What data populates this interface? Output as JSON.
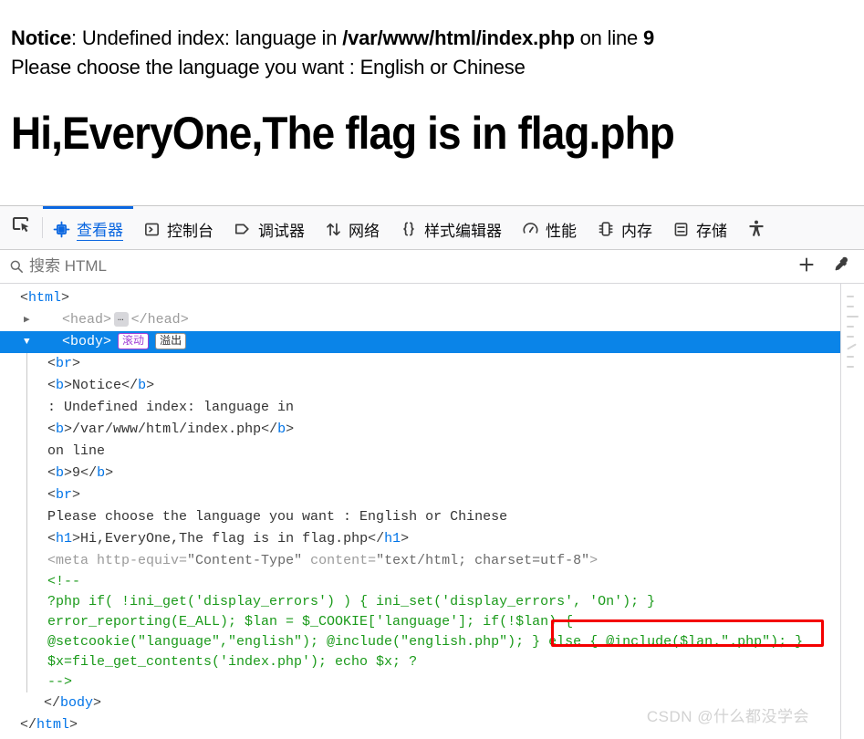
{
  "rendered_page": {
    "notice_prefix_bold": "Notice",
    "notice_middle": ": Undefined index: language in ",
    "notice_path_bold": "/var/www/html/index.php",
    "notice_online": " on line ",
    "notice_line_bold": "9",
    "second_line": "Please choose the language you want : English or Chinese",
    "heading": "Hi,EveryOne,The flag is in flag.php"
  },
  "devtools": {
    "picker_icon": "element-picker-icon",
    "tabs": [
      {
        "label": "查看器",
        "icon": "inspector-icon",
        "active": true
      },
      {
        "label": "控制台",
        "icon": "console-icon",
        "active": false
      },
      {
        "label": "调试器",
        "icon": "debugger-icon",
        "active": false
      },
      {
        "label": "网络",
        "icon": "network-icon",
        "active": false
      },
      {
        "label": "样式编辑器",
        "icon": "style-editor-icon",
        "active": false
      },
      {
        "label": "性能",
        "icon": "performance-icon",
        "active": false
      },
      {
        "label": "内存",
        "icon": "memory-icon",
        "active": false
      },
      {
        "label": "存储",
        "icon": "storage-icon",
        "active": false
      },
      {
        "label": "",
        "icon": "accessibility-icon",
        "active": false
      }
    ],
    "search": {
      "placeholder": "搜索 HTML",
      "value": "",
      "icon": "search-icon",
      "add_node_icon": "add-node-icon",
      "eyedropper_icon": "eyedropper-icon"
    },
    "accent_color": "#0a66e0",
    "selection_color": "#0a84e8",
    "highlight_color": "#f40000"
  },
  "markup": {
    "badges": {
      "scroll": "滚动",
      "overflow": "溢出"
    },
    "rows": {
      "html_open": {
        "open": "<",
        "name": "html",
        "close": ">"
      },
      "head": {
        "open": "<",
        "name": "head",
        "close": ">",
        "ellipsis": "…",
        "close_open": "</",
        "close_name": "head",
        "close_end": ">"
      },
      "body_open": {
        "open": "<",
        "name": "body",
        "close": ">"
      },
      "br1": "<br>",
      "b_notice_open": "<b>",
      "b_notice_text": "Notice",
      "b_notice_close": "</b>",
      "text_undefined": ": Undefined index: language in",
      "b_path_open": "<b>",
      "b_path_text": "/var/www/html/index.php",
      "b_path_close": "</b>",
      "text_online": "on line",
      "b_nine_open": "<b>",
      "b_nine_text": "9",
      "b_nine_close": "</b>",
      "br2": "<br>",
      "text_please": "Please choose the language you want : English or Chinese",
      "h1_open": "<h1>",
      "h1_text": "Hi,EveryOne,The flag is in flag.php",
      "h1_close": "</h1>",
      "meta_open": "<meta ",
      "meta_attr1_name": "http-equiv",
      "meta_attr1_val": "\"Content-Type\"",
      "meta_attr2_name": "content",
      "meta_attr2_val": "\"text/html; charset=utf-8\"",
      "meta_close": ">",
      "comment_start": "<!--",
      "comment_l1": "?php if( !ini_get('display_errors') ) { ini_set('display_errors', 'On'); }",
      "comment_l2": "error_reporting(E_ALL); $lan = $_COOKIE['language']; if(!$lan) {",
      "comment_l3a": "@setcookie(\"language\",\"english\"); @include(\"english.php\"); }",
      "comment_l3b": "else { @include($lan.\".php\"); }",
      "comment_l4": "$x=file_get_contents('index.php'); echo $x; ?",
      "comment_end": "-->",
      "body_close": "</body>",
      "html_close": "</html>"
    }
  },
  "watermark": "CSDN @什么都没学会"
}
